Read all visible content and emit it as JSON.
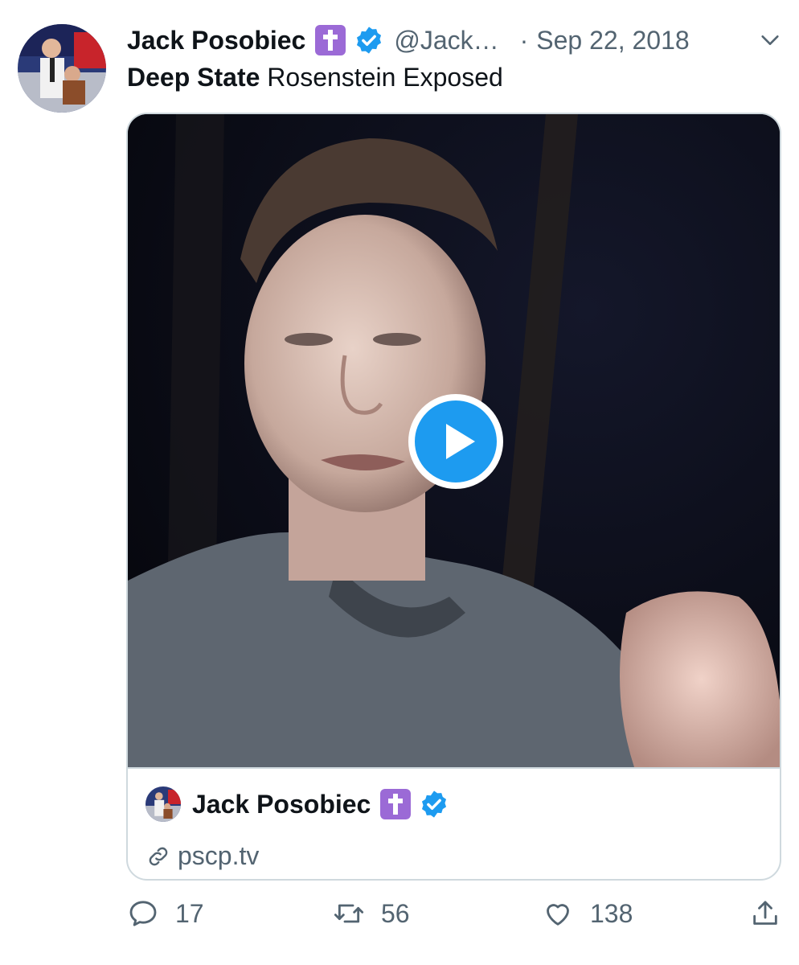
{
  "tweet": {
    "author_name": "Jack Posobiec",
    "handle": "@Jack…",
    "separator": "·",
    "date": "Sep 22, 2018",
    "text_bold": "Deep State",
    "text_rest": " Rosenstein Exposed"
  },
  "card": {
    "author_name": "Jack Posobiec",
    "link_text": "pscp.tv"
  },
  "actions": {
    "replies": "17",
    "retweets": "56",
    "likes": "138"
  },
  "icons": {
    "cross": "latin-cross-emoji",
    "verified": "verified-badge-icon",
    "play": "play-icon"
  },
  "colors": {
    "verified": "#1d9bf0",
    "secondary_text": "#536471",
    "cross_badge": "#9b6ad6"
  }
}
